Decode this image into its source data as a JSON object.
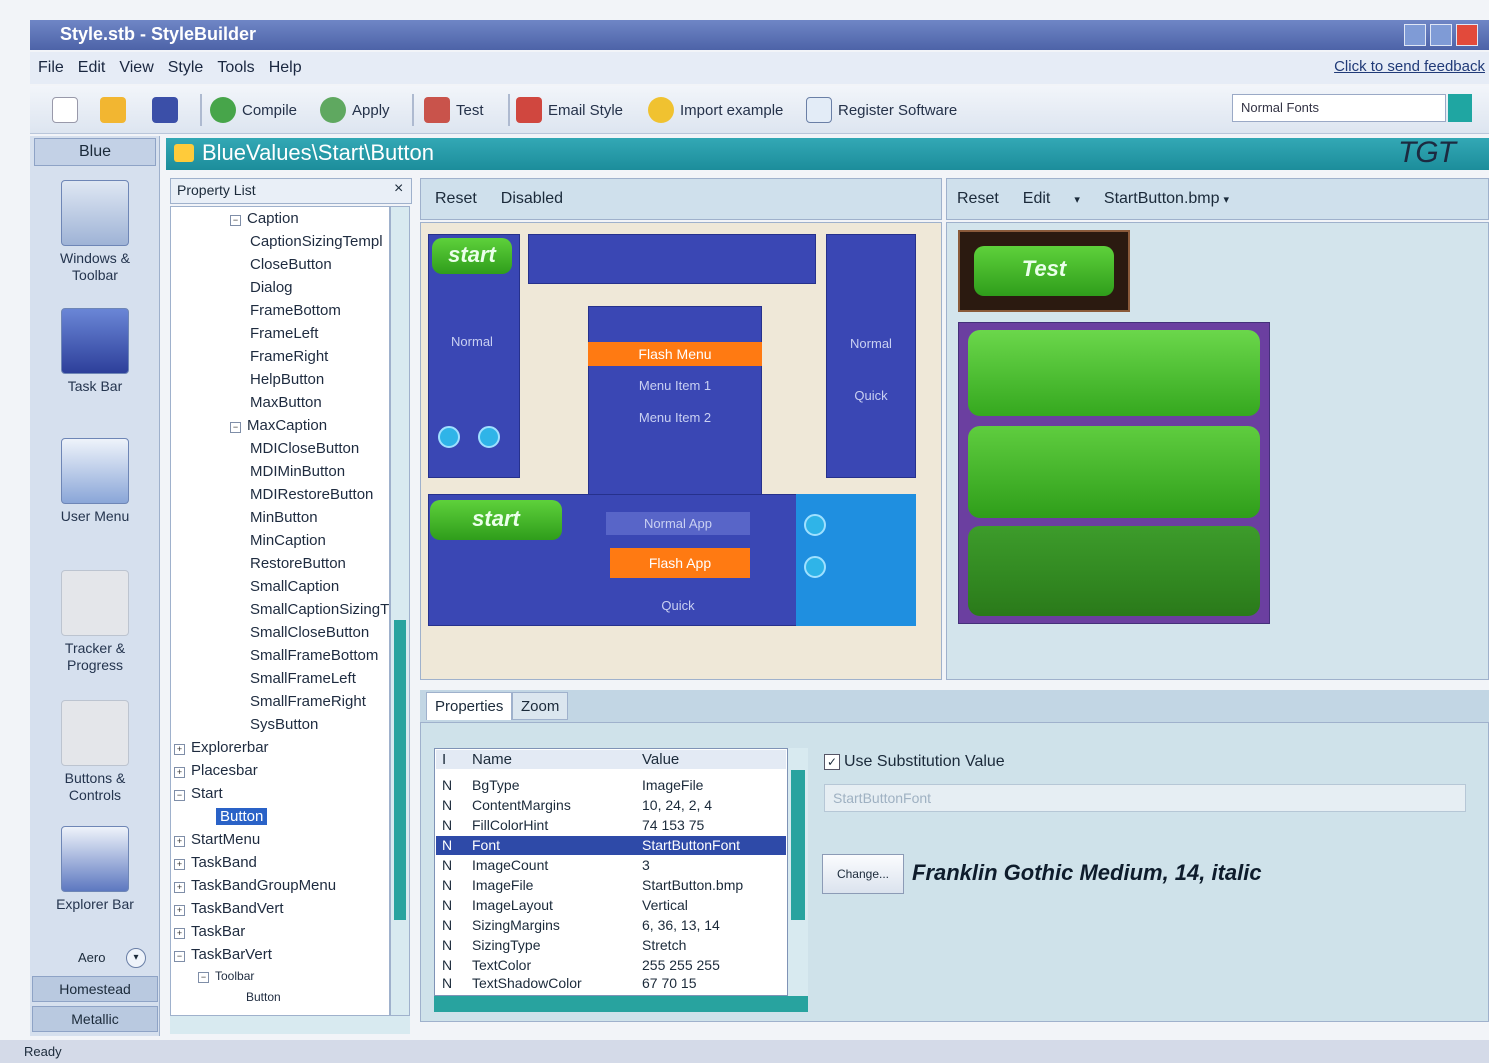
{
  "window": {
    "title": "Style.stb - StyleBuilder"
  },
  "menu": {
    "items": [
      "File",
      "Edit",
      "View",
      "Style",
      "Tools",
      "Help"
    ],
    "feedback_link": "Click to send feedback"
  },
  "toolbar": {
    "compile": "Compile",
    "apply": "Apply",
    "test": "Test",
    "email_style": "Email Style",
    "import_example": "Import example",
    "register": "Register Software",
    "font_select": "Normal Fonts"
  },
  "gallery": {
    "header": "Blue",
    "items": [
      "Windows & Toolbar",
      "Task Bar",
      "User Menu",
      "Tracker & Progress",
      "Buttons & Controls",
      "Explorer Bar"
    ],
    "more": "Aero",
    "footer": [
      "Homestead",
      "Metallic"
    ]
  },
  "style_header": {
    "title": "BlueValues\\Start\\Button",
    "logo": "TGT"
  },
  "tree": {
    "header": "Property List",
    "caption_children": [
      "CaptionSizingTempl",
      "CloseButton",
      "Dialog",
      "FrameBottom",
      "FrameLeft",
      "FrameRight",
      "HelpButton",
      "MaxButton"
    ],
    "caption": "Caption",
    "maxcaption": "MaxCaption",
    "maxcaption_children": [
      "MDICloseButton",
      "MDIMinButton",
      "MDIRestoreButton",
      "MinButton",
      "MinCaption",
      "RestoreButton",
      "SmallCaption",
      "SmallCaptionSizingT",
      "SmallCloseButton",
      "SmallFrameBottom",
      "SmallFrameLeft",
      "SmallFrameRight",
      "SysButton"
    ],
    "roots": [
      "Explorerbar",
      "Placesbar"
    ],
    "start": "Start",
    "start_child": "Button",
    "roots2": [
      "StartMenu",
      "TaskBand",
      "TaskBandGroupMenu",
      "TaskBandVert",
      "TaskBar",
      "TaskBarVert"
    ],
    "toolbar": "Toolbar",
    "toolbar_child": "Button"
  },
  "preview_left": {
    "toolbar": [
      "Reset",
      "Disabled"
    ],
    "start_small": "start",
    "start_big": "start",
    "normal": "Normal",
    "flash_menu": "Flash Menu",
    "menu_item1": "Menu Item 1",
    "menu_item2": "Menu Item 2",
    "quick": "Quick",
    "normal_app": "Normal App",
    "flash_app": "Flash App",
    "quick2": "Quick"
  },
  "preview_right": {
    "toolbar": [
      "Reset",
      "Edit",
      "StartButton.bmp"
    ],
    "test_button": "Test"
  },
  "tabs": [
    "Properties",
    "Zoom"
  ],
  "grid": {
    "headers": [
      "I",
      "Name",
      "Value"
    ],
    "rows": [
      [
        "N",
        "BgType",
        "ImageFile"
      ],
      [
        "N",
        "ContentMargins",
        "10, 24, 2, 4"
      ],
      [
        "N",
        "FillColorHint",
        "74 153 75"
      ],
      [
        "N",
        "Font",
        "StartButtonFont"
      ],
      [
        "N",
        "ImageCount",
        "3"
      ],
      [
        "N",
        "ImageFile",
        "StartButton.bmp"
      ],
      [
        "N",
        "ImageLayout",
        "Vertical"
      ],
      [
        "N",
        "SizingMargins",
        "6, 36, 13, 14"
      ],
      [
        "N",
        "SizingType",
        "Stretch"
      ],
      [
        "N",
        "TextColor",
        "255 255 255"
      ],
      [
        "N",
        "TextShadowColor",
        "67 70 15"
      ]
    ]
  },
  "substitution": {
    "label": "Use Substitution Value",
    "value": "StartButtonFont",
    "change_button": "Change...",
    "font_description": "Franklin Gothic Medium, 14, italic"
  },
  "statusbar": "Ready",
  "colors": {
    "accent_teal": "#1c8d9b",
    "preview_blue": "#3a47b4",
    "start_green": "#3fb226",
    "flash_orange": "#ff7a12",
    "selection": "#2e4aa8"
  }
}
